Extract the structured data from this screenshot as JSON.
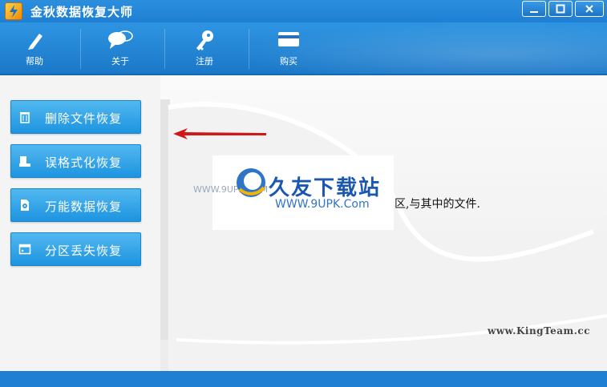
{
  "window": {
    "title": "金秋数据恢复大师",
    "controls": [
      "minimize",
      "maximize",
      "close"
    ]
  },
  "toolbar": {
    "items": [
      {
        "label": "帮助",
        "icon": "pen-icon"
      },
      {
        "label": "关于",
        "icon": "chat-bubbles-icon"
      },
      {
        "label": "注册",
        "icon": "key-icon"
      },
      {
        "label": "购买",
        "icon": "card-icon"
      }
    ]
  },
  "sidebar": {
    "items": [
      {
        "label": "删除文件恢复",
        "icon": "trash-icon"
      },
      {
        "label": "误格式化恢复",
        "icon": "drive-icon"
      },
      {
        "label": "万能数据恢复",
        "icon": "disk-file-icon"
      },
      {
        "label": "分区丢失恢复",
        "icon": "partition-icon"
      }
    ]
  },
  "content": {
    "description": "分区,与其中的文件."
  },
  "watermark": {
    "cn": "久友下载站",
    "en": "WWW.9UPK.Com",
    "small": "WWW.9UPK.COM"
  },
  "footer": {
    "brand": "www.KingTeam.cc"
  },
  "colors": {
    "accent": "#1f7fd3",
    "button": "#2a9fe6",
    "arrow": "#d01818"
  }
}
